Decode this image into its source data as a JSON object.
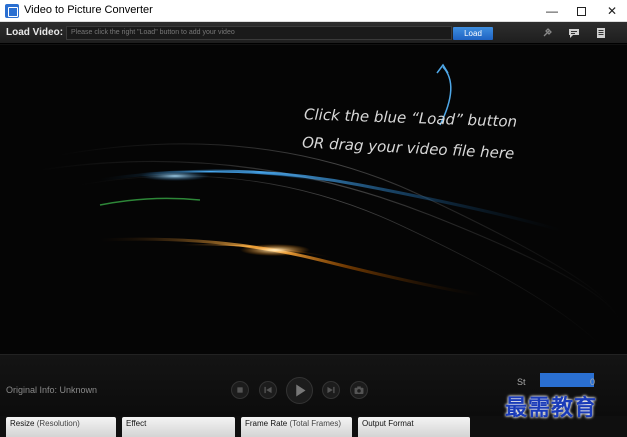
{
  "window": {
    "title": "Video to Picture Converter",
    "min_glyph": "—",
    "close_glyph": "✕"
  },
  "load_bar": {
    "label": "Load Video:",
    "placeholder": "Please click the right \"Load\" button to add your video",
    "load_button": "Load",
    "icons": [
      "settings-icon",
      "chat-icon",
      "document-icon"
    ]
  },
  "viewport": {
    "hint_line1": "Click the blue “Load” button",
    "hint_line2": "OR drag your video file here"
  },
  "controls": {
    "original_info": "Original Info: Unknown",
    "start_label": "St",
    "start_value": "0"
  },
  "panels": {
    "resize": "Resize",
    "resize_sub": "(Resolution)",
    "effect": "Effect",
    "frame_rate": "Frame Rate",
    "frame_rate_sub": "(Total Frames)",
    "output_format": "Output Format"
  },
  "watermark": "最需教育",
  "colors": {
    "accent": "#2a6fd1",
    "background": "#050505"
  }
}
